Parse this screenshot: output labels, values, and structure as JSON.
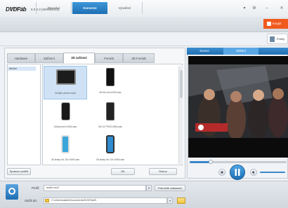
{
  "app": {
    "logo": "DVDFab",
    "version": "9.0.0.3 (09/09/2013)"
  },
  "window_controls": [
    "▾",
    "⚙",
    "–",
    "✕"
  ],
  "nav": {
    "tabs": [
      "Kopírování",
      "Ripování",
      "Konverze",
      "Vytváření"
    ],
    "active_index": 2
  },
  "buy_label": "Koupit",
  "pref_label": "Profily",
  "profile_tabs": {
    "items": [
      "Hardware",
      "Zařízení",
      "3D zařízení",
      "Formát",
      "3D Formát"
    ],
    "active_index": 2
  },
  "brand_list": [
    "device"
  ],
  "devices": [
    {
      "name": "3d.kjfm-phone.mp3",
      "selected": true
    },
    {
      "name": "3d.htc.evo.h264.aac",
      "selected": false
    },
    {
      "name": "3d.iphone4.h264.aac",
      "selected": false
    },
    {
      "name": "3d.LG P920.h264.aac",
      "selected": false
    },
    {
      "name": "3d.sharp.sh.10c.h264.aac",
      "selected": false
    },
    {
      "name": "3d.sharp.sh.12c.h264.aac",
      "selected": false
    }
  ],
  "buttons": {
    "manage": "Správce profilů",
    "ok": "OK",
    "cancel": "Storno"
  },
  "preview_tabs": {
    "items": [
      "Source",
      "Náhled"
    ],
    "active_index": 1
  },
  "playback": {
    "progress": 0.22
  },
  "bottom": {
    "profile_label": "Profil:",
    "profile_value": "audio.mp3",
    "profile_settings": "Pokročilé nastavení",
    "save_label": "Uložit do:",
    "save_value": "C:\\Users\\radek\\Documents\\DVDFab9\\"
  },
  "colors": {
    "accent": "#1d6fb4",
    "buy": "#f05a1e",
    "folder": "#f4c23b"
  }
}
